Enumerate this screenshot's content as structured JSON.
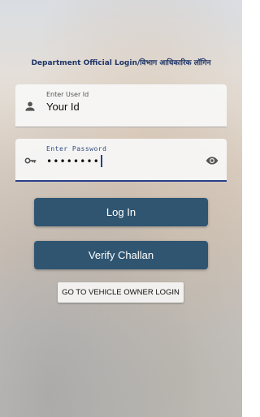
{
  "heading": "Department Official Login/विभाग आधिकारिक लॉगिन",
  "user_field": {
    "label": "Enter User Id",
    "value": "Your Id",
    "icon": "person-icon"
  },
  "password_field": {
    "label": "Enter Password",
    "value": "••••••••",
    "icon": "key-icon",
    "toggle_icon": "eye-icon"
  },
  "buttons": {
    "login": "Log In",
    "verify_challan": "Verify Challan",
    "vehicle_owner_login": "GO TO VEHICLE OWNER LOGIN"
  },
  "colors": {
    "button_bg": "#2f5571",
    "heading": "#1f3566",
    "focus_underline": "#2a3f8a"
  }
}
